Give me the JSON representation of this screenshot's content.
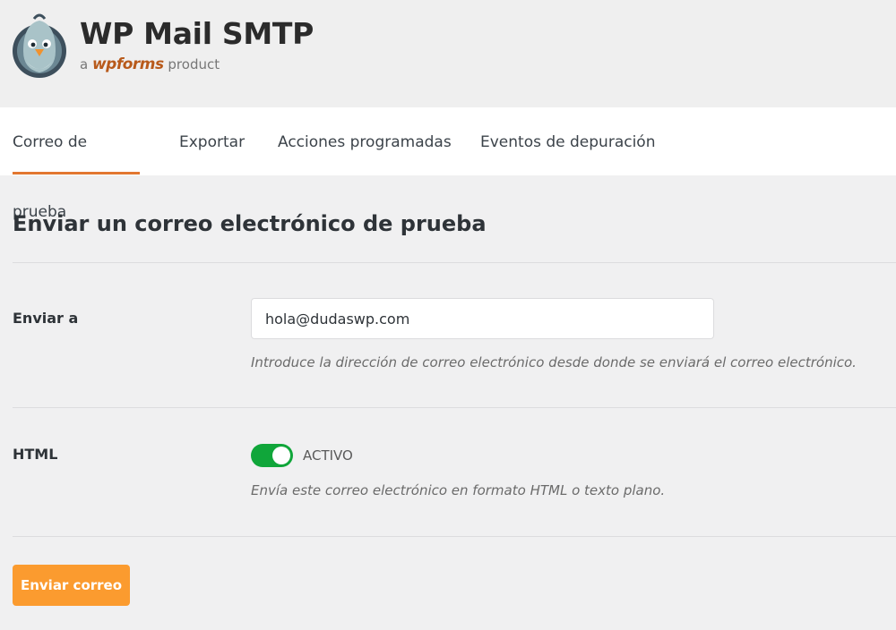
{
  "brand": {
    "title": "WP Mail SMTP",
    "sub_prefix": "a ",
    "sub_brand": "wpforms",
    "sub_suffix": " product",
    "logo_icon": "pigeon-mascot-icon"
  },
  "tabs": [
    {
      "label": "Correo de prueba",
      "active": true
    },
    {
      "label": "Exportar",
      "active": false
    },
    {
      "label": "Acciones programadas",
      "active": false
    },
    {
      "label": "Eventos de depuración",
      "active": false
    }
  ],
  "section": {
    "title": "Enviar un correo electrónico de prueba"
  },
  "send_to": {
    "label": "Enviar a",
    "value": "hola@dudaswp.com",
    "description": "Introduce la dirección de correo electrónico desde donde se enviará el correo electrónico."
  },
  "html_option": {
    "label": "HTML",
    "toggle_on": true,
    "toggle_text": "ACTIVO",
    "description": "Envía este correo electrónico en formato HTML o texto plano."
  },
  "submit": {
    "label": "Enviar correo"
  },
  "colors": {
    "accent": "#e27730",
    "button": "#fb9b2f",
    "toggle_on": "#10a63a"
  }
}
